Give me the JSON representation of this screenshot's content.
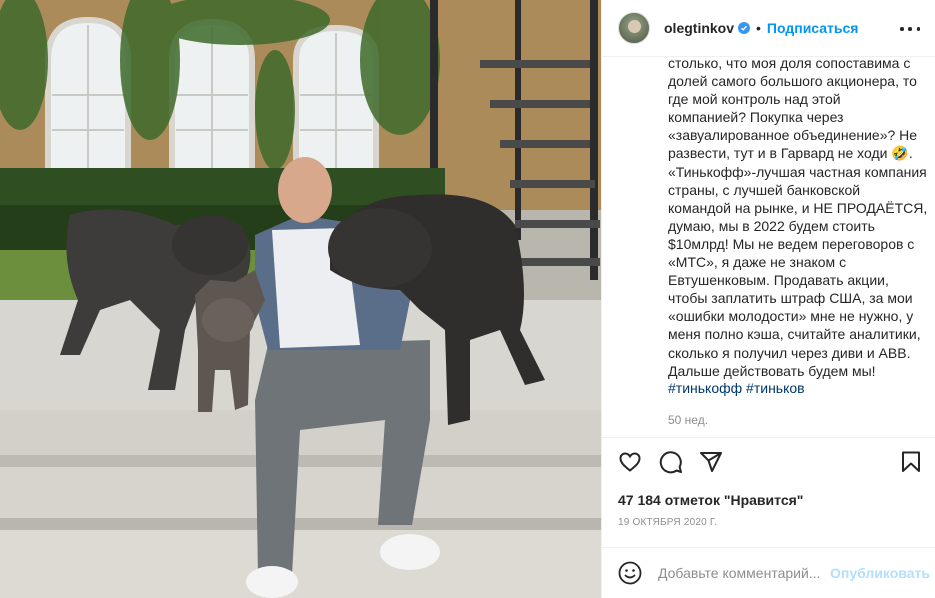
{
  "photo": {
    "alt_icon": "photo-of-man-with-dogs"
  },
  "header": {
    "username": "olegtinkov",
    "verified_icon": "verified-badge-icon",
    "separator": "•",
    "follow_label": "Подписаться",
    "more_icon": "more-options-icon"
  },
  "caption": {
    "text": "столько, что моя доля сопоставима с\nдолей самого большого акционера, то\nгде мой контроль над этой\nкомпанией? Покупка через\n«завуалированное объединение»? Не\nразвести, тут и в Гарвард не ходи 🤣.\n«Тинькофф»-лучшая частная компания\nстраны, с лучшей банковской\nкомандой на рынке, и НЕ ПРОДАЁТСЯ,\nдумаю, мы в 2022 будем стоить\n$10млрд! Мы не ведем переговоров с\n«МТС», я даже не знаком с\nЕвтушенковым. Продавать акции,\nчтобы заплатить штраф США, за мои\n«ошибки молодости» мне не нужно, у\nменя полно кэша, считайте аналитики,\nсколько я получил через диви и ABB.\nДальше действовать будем мы!",
    "hashtags": [
      "#тинькофф",
      "#тиньков"
    ],
    "age": "50 нед."
  },
  "actions": {
    "like_icon": "heart-icon",
    "comment_icon": "comment-icon",
    "share_icon": "share-icon",
    "save_icon": "bookmark-icon"
  },
  "likes": {
    "text": "47 184 отметок \"Нравится\""
  },
  "date": "19 ОКТЯБРЯ 2020 Г.",
  "comment": {
    "emoji_icon": "emoji-icon",
    "placeholder": "Добавьте комментарий...",
    "publish_label": "Опубликовать"
  },
  "colors": {
    "accent": "#0095f6",
    "publish_disabled": "#b2dffc",
    "hashtag": "#00376b",
    "muted": "#8e8e8e",
    "border": "#efefef"
  }
}
